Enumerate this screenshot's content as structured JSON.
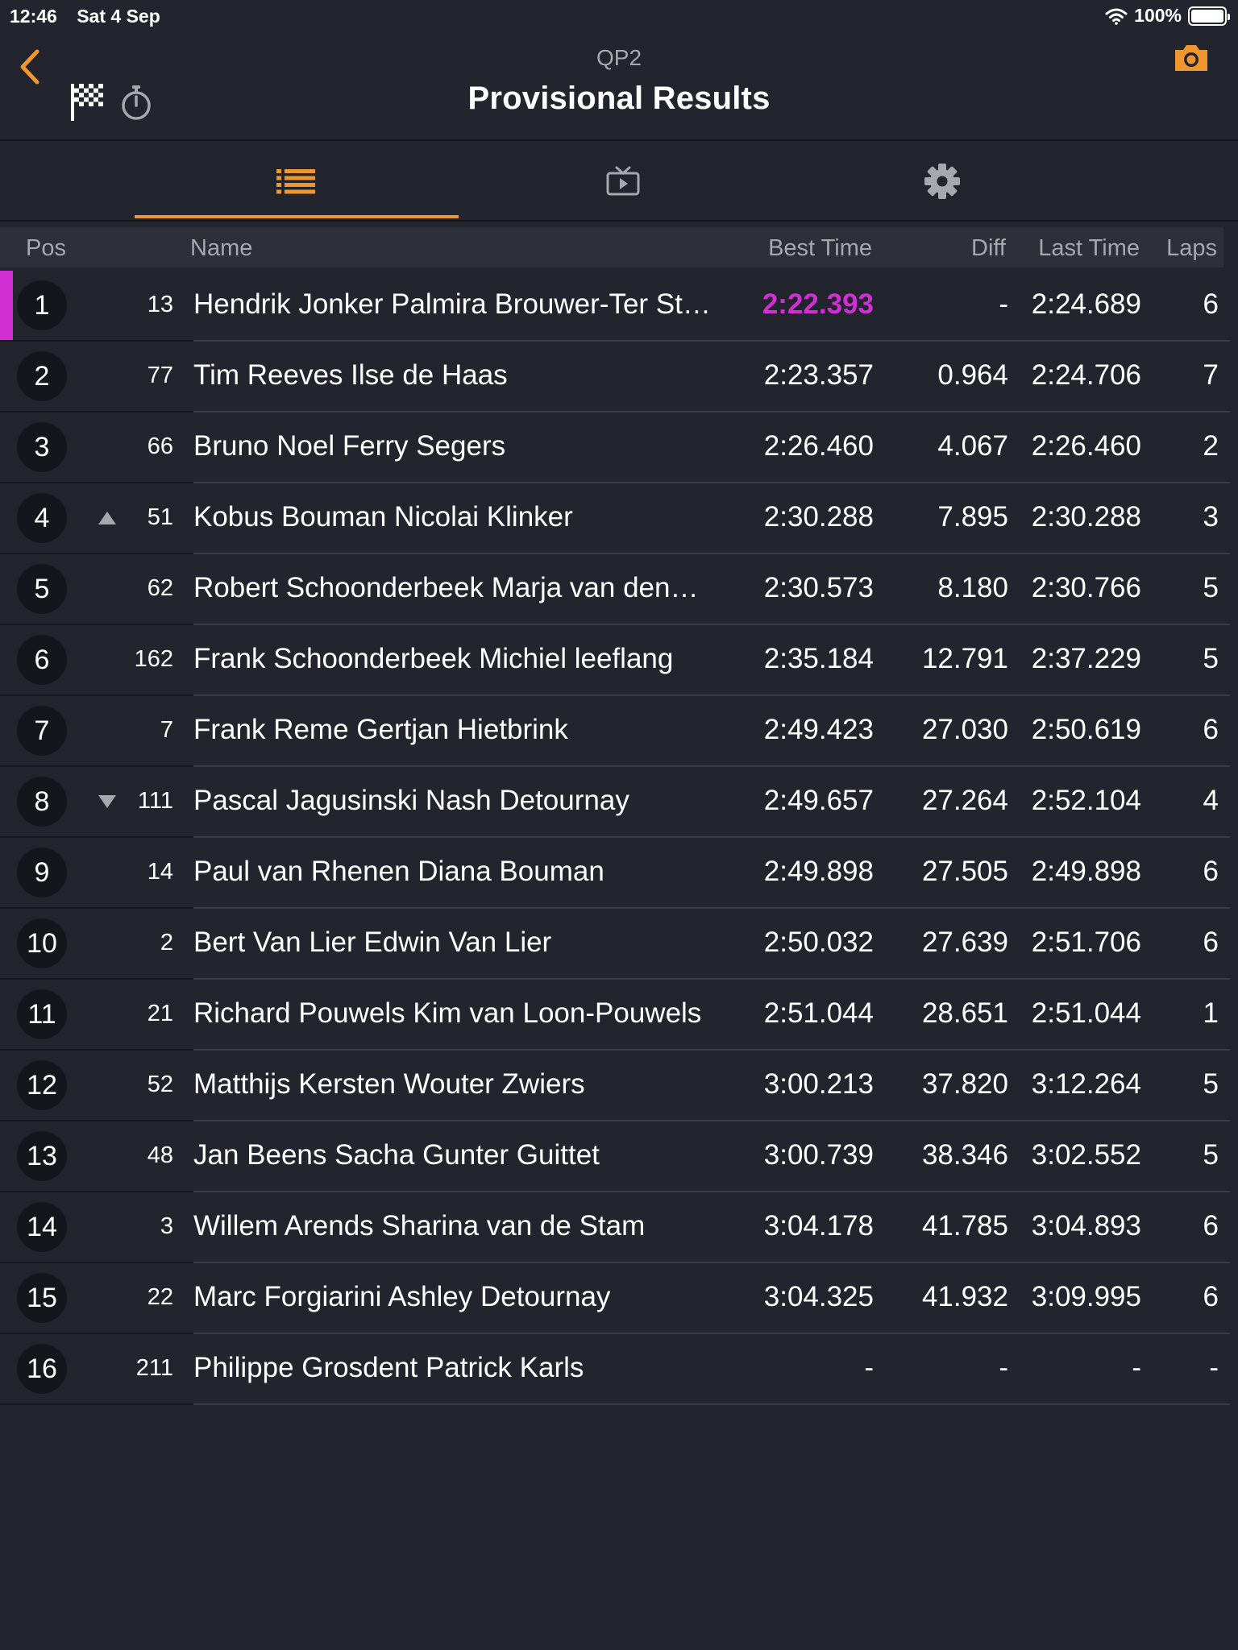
{
  "status": {
    "time": "12:46",
    "date": "Sat 4 Sep",
    "battery": "100%"
  },
  "nav": {
    "subtitle": "QP2",
    "title": "Provisional Results"
  },
  "tabs": [
    {
      "name": "results-list",
      "icon": "list-icon",
      "active": true
    },
    {
      "name": "video",
      "icon": "tv-play-icon",
      "active": false
    },
    {
      "name": "settings",
      "icon": "gear-icon",
      "active": false
    }
  ],
  "colors": {
    "accent": "#f0962e",
    "fastest": "#d12fd3",
    "background": "#22252d"
  },
  "columns": {
    "pos": "Pos",
    "name": "Name",
    "best": "Best Time",
    "diff": "Diff",
    "last": "Last Time",
    "laps": "Laps"
  },
  "rows": [
    {
      "pos": "1",
      "num": "13",
      "name": "Hendrik Jonker Palmira Brouwer-Ter St…",
      "best": "2:22.393",
      "diff": "-",
      "last": "2:24.689",
      "laps": "6",
      "fastest": true,
      "trend": ""
    },
    {
      "pos": "2",
      "num": "77",
      "name": "Tim Reeves Ilse de Haas",
      "best": "2:23.357",
      "diff": "0.964",
      "last": "2:24.706",
      "laps": "7",
      "trend": ""
    },
    {
      "pos": "3",
      "num": "66",
      "name": "Bruno Noel Ferry Segers",
      "best": "2:26.460",
      "diff": "4.067",
      "last": "2:26.460",
      "laps": "2",
      "trend": ""
    },
    {
      "pos": "4",
      "num": "51",
      "name": "Kobus Bouman Nicolai Klinker",
      "best": "2:30.288",
      "diff": "7.895",
      "last": "2:30.288",
      "laps": "3",
      "trend": "up"
    },
    {
      "pos": "5",
      "num": "62",
      "name": "Robert Schoonderbeek Marja van den…",
      "best": "2:30.573",
      "diff": "8.180",
      "last": "2:30.766",
      "laps": "5",
      "trend": ""
    },
    {
      "pos": "6",
      "num": "162",
      "name": "Frank Schoonderbeek Michiel leeflang",
      "best": "2:35.184",
      "diff": "12.791",
      "last": "2:37.229",
      "laps": "5",
      "trend": ""
    },
    {
      "pos": "7",
      "num": "7",
      "name": "Frank Reme Gertjan Hietbrink",
      "best": "2:49.423",
      "diff": "27.030",
      "last": "2:50.619",
      "laps": "6",
      "trend": ""
    },
    {
      "pos": "8",
      "num": "111",
      "name": "Pascal Jagusinski Nash Detournay",
      "best": "2:49.657",
      "diff": "27.264",
      "last": "2:52.104",
      "laps": "4",
      "trend": "down"
    },
    {
      "pos": "9",
      "num": "14",
      "name": "Paul van Rhenen Diana Bouman",
      "best": "2:49.898",
      "diff": "27.505",
      "last": "2:49.898",
      "laps": "6",
      "trend": ""
    },
    {
      "pos": "10",
      "num": "2",
      "name": "Bert Van Lier Edwin Van Lier",
      "best": "2:50.032",
      "diff": "27.639",
      "last": "2:51.706",
      "laps": "6",
      "trend": ""
    },
    {
      "pos": "11",
      "num": "21",
      "name": "Richard Pouwels Kim van Loon-Pouwels",
      "best": "2:51.044",
      "diff": "28.651",
      "last": "2:51.044",
      "laps": "1",
      "trend": ""
    },
    {
      "pos": "12",
      "num": "52",
      "name": "Matthijs Kersten Wouter Zwiers",
      "best": "3:00.213",
      "diff": "37.820",
      "last": "3:12.264",
      "laps": "5",
      "trend": ""
    },
    {
      "pos": "13",
      "num": "48",
      "name": "Jan Beens Sacha Gunter Guittet",
      "best": "3:00.739",
      "diff": "38.346",
      "last": "3:02.552",
      "laps": "5",
      "trend": ""
    },
    {
      "pos": "14",
      "num": "3",
      "name": "Willem Arends Sharina van de Stam",
      "best": "3:04.178",
      "diff": "41.785",
      "last": "3:04.893",
      "laps": "6",
      "trend": ""
    },
    {
      "pos": "15",
      "num": "22",
      "name": "Marc Forgiarini Ashley Detournay",
      "best": "3:04.325",
      "diff": "41.932",
      "last": "3:09.995",
      "laps": "6",
      "trend": ""
    },
    {
      "pos": "16",
      "num": "211",
      "name": "Philippe Grosdent Patrick Karls",
      "best": "-",
      "diff": "-",
      "last": "-",
      "laps": "-",
      "trend": ""
    }
  ]
}
